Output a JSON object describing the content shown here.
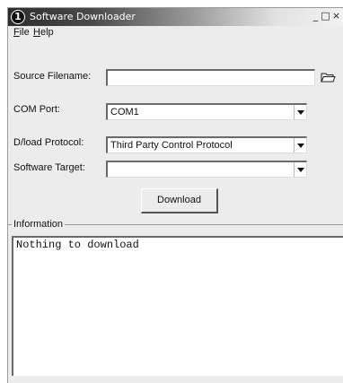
{
  "window": {
    "title": "Software Downloader",
    "app_icon": "1",
    "controls": {
      "minimize": "_",
      "maximize": "□",
      "close": "×"
    }
  },
  "menu": {
    "file": {
      "accel": "F",
      "rest": "ile"
    },
    "help": {
      "accel": "H",
      "rest": "elp"
    }
  },
  "form": {
    "source_filename": {
      "label": "Source Filename:",
      "value": ""
    },
    "com_port": {
      "label": "COM Port:",
      "value": "COM1"
    },
    "dload_protocol": {
      "label": "D/load Protocol:",
      "value": "Third Party Control Protocol"
    },
    "software_target": {
      "label": "Software Target:",
      "value": ""
    },
    "browse_icon": "folder-open-icon"
  },
  "actions": {
    "download_label": "Download"
  },
  "information": {
    "label": "Information",
    "text": "Nothing to download"
  }
}
